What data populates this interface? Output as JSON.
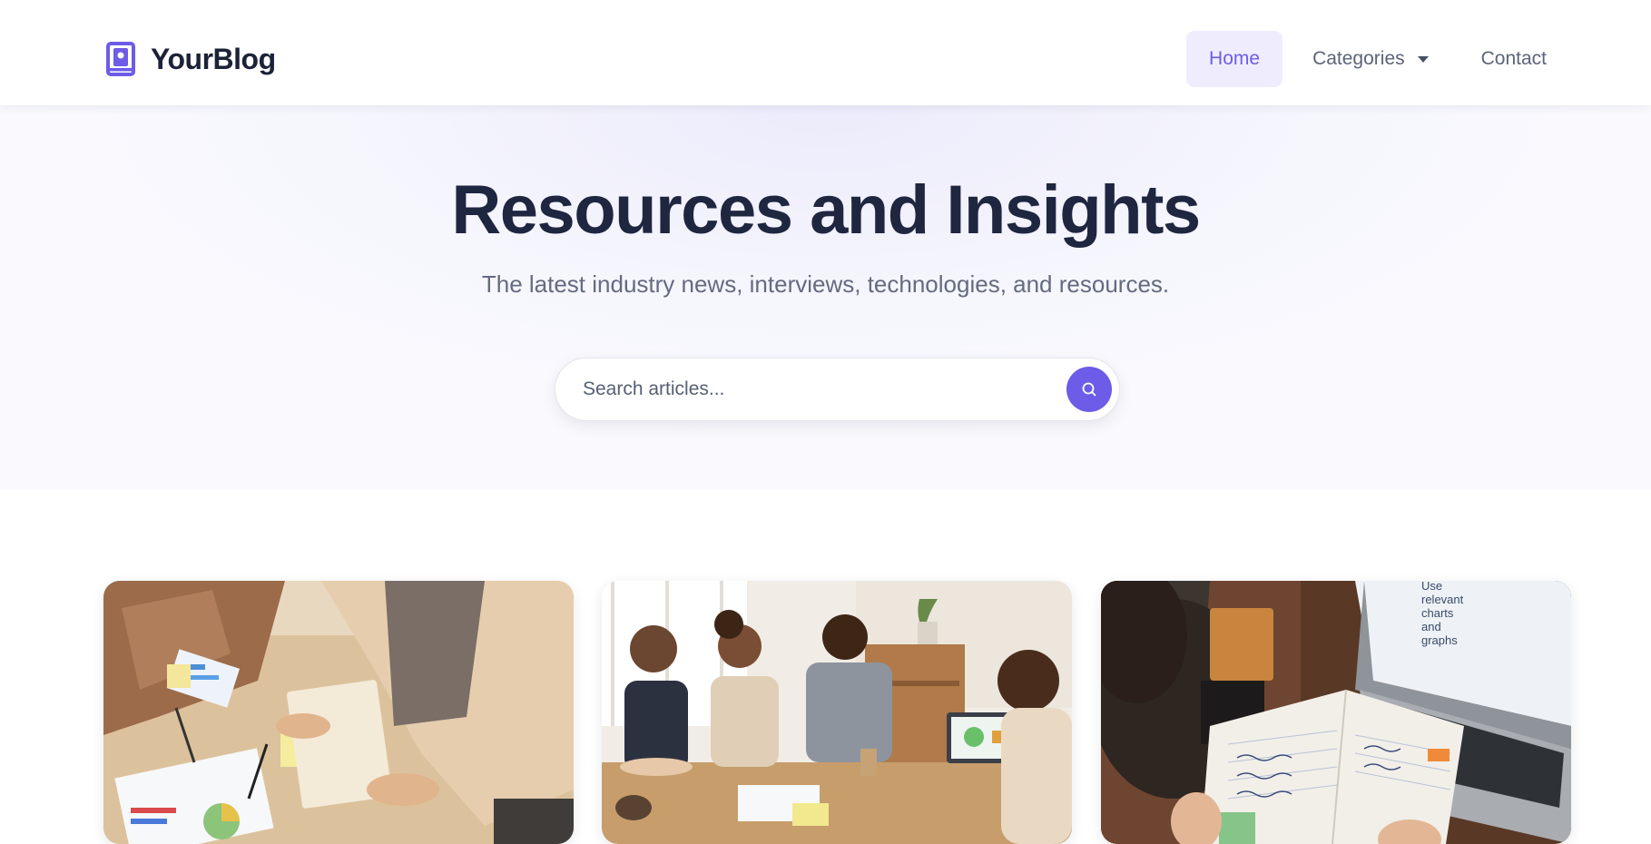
{
  "brand": {
    "name": "YourBlog",
    "icon": "bookmark-book-icon"
  },
  "nav": {
    "items": [
      {
        "label": "Home",
        "active": true
      },
      {
        "label": "Categories",
        "dropdown": true
      },
      {
        "label": "Contact"
      }
    ]
  },
  "hero": {
    "title": "Resources and Insights",
    "subtitle": "The latest industry news, interviews, technologies, and resources.",
    "search": {
      "placeholder": "Search articles...",
      "button_icon": "search-icon"
    }
  },
  "cards": [
    {
      "image": "photo-team-working-with-charts"
    },
    {
      "image": "photo-team-meeting-at-table"
    },
    {
      "image": "photo-notebook-and-laptop",
      "image_text": [
        "Use",
        "relevant",
        "charts",
        "and",
        "graphs"
      ]
    }
  ],
  "colors": {
    "accent": "#6c5ce7",
    "accent_soft": "#efedfd",
    "heading": "#1f2640",
    "muted": "#646b80"
  }
}
